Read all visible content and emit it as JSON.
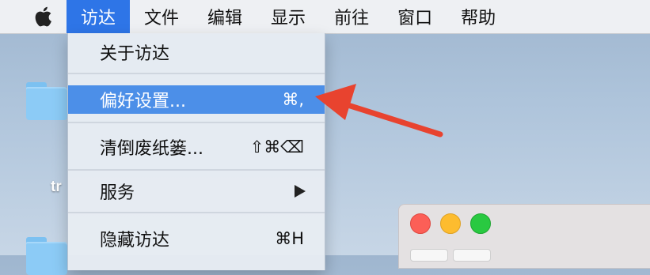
{
  "menubar": {
    "apple_icon": "apple-logo-icon",
    "items": [
      {
        "label": "访达",
        "active": true
      },
      {
        "label": "文件"
      },
      {
        "label": "编辑"
      },
      {
        "label": "显示"
      },
      {
        "label": "前往"
      },
      {
        "label": "窗口"
      },
      {
        "label": "帮助"
      }
    ]
  },
  "menu": {
    "items": [
      {
        "label": "关于访达",
        "shortcut": ""
      },
      {
        "label": "偏好设置...",
        "shortcut": "⌘,",
        "selected": true
      },
      {
        "label": "清倒废纸篓...",
        "shortcut": "⇧⌘⌫"
      },
      {
        "label": "服务",
        "submenu": true
      },
      {
        "label": "隐藏访达",
        "shortcut": "⌘H"
      }
    ]
  },
  "desktop": {
    "item_label": "tr"
  },
  "colors": {
    "selection": "#4c8fe8",
    "menubar_active": "#2e75e7",
    "annotation_arrow": "#e8432f"
  }
}
